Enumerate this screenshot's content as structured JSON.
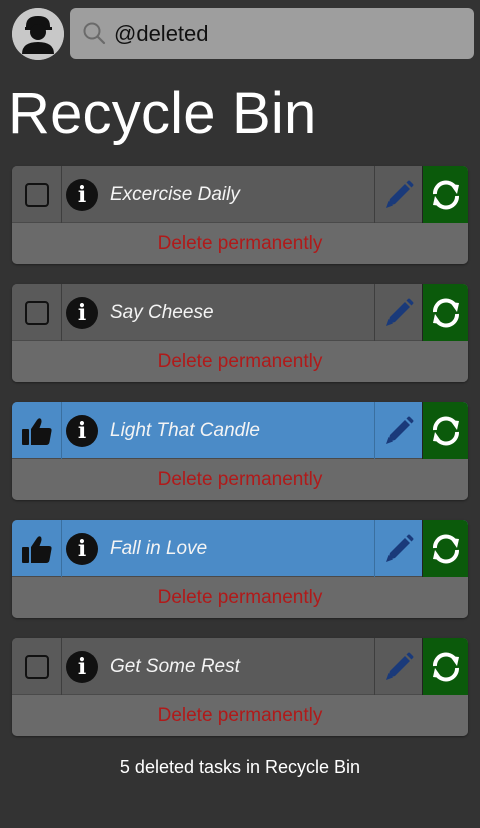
{
  "search": {
    "value": "@deleted"
  },
  "page_title": "Recycle Bin",
  "tasks": [
    {
      "name": "Excercise Daily",
      "status": "unchecked",
      "action": "Delete permanently"
    },
    {
      "name": "Say Cheese",
      "status": "unchecked",
      "action": "Delete permanently"
    },
    {
      "name": "Light That Candle",
      "status": "completed",
      "action": "Delete permanently"
    },
    {
      "name": "Fall in Love",
      "status": "completed",
      "action": "Delete permanently"
    },
    {
      "name": "Get Some Rest",
      "status": "unchecked",
      "action": "Delete permanently"
    }
  ],
  "footer_text": "5 deleted tasks in Recycle Bin",
  "info_glyph": "i",
  "icons": {
    "avatar": "user-avatar-icon",
    "search": "magnifier-icon",
    "status_unchecked": "checkbox-icon",
    "status_completed": "thumbs-up-icon",
    "info": "info-icon",
    "edit": "pencil-icon",
    "restore": "restore-arrows-icon"
  },
  "colors": {
    "background": "#333333",
    "row_default": "#5a5a5a",
    "row_completed": "#4b8bc7",
    "restore_button": "#0b5a0b",
    "delete_text": "#b01a1a",
    "edit_icon": "#1a3a7a"
  }
}
